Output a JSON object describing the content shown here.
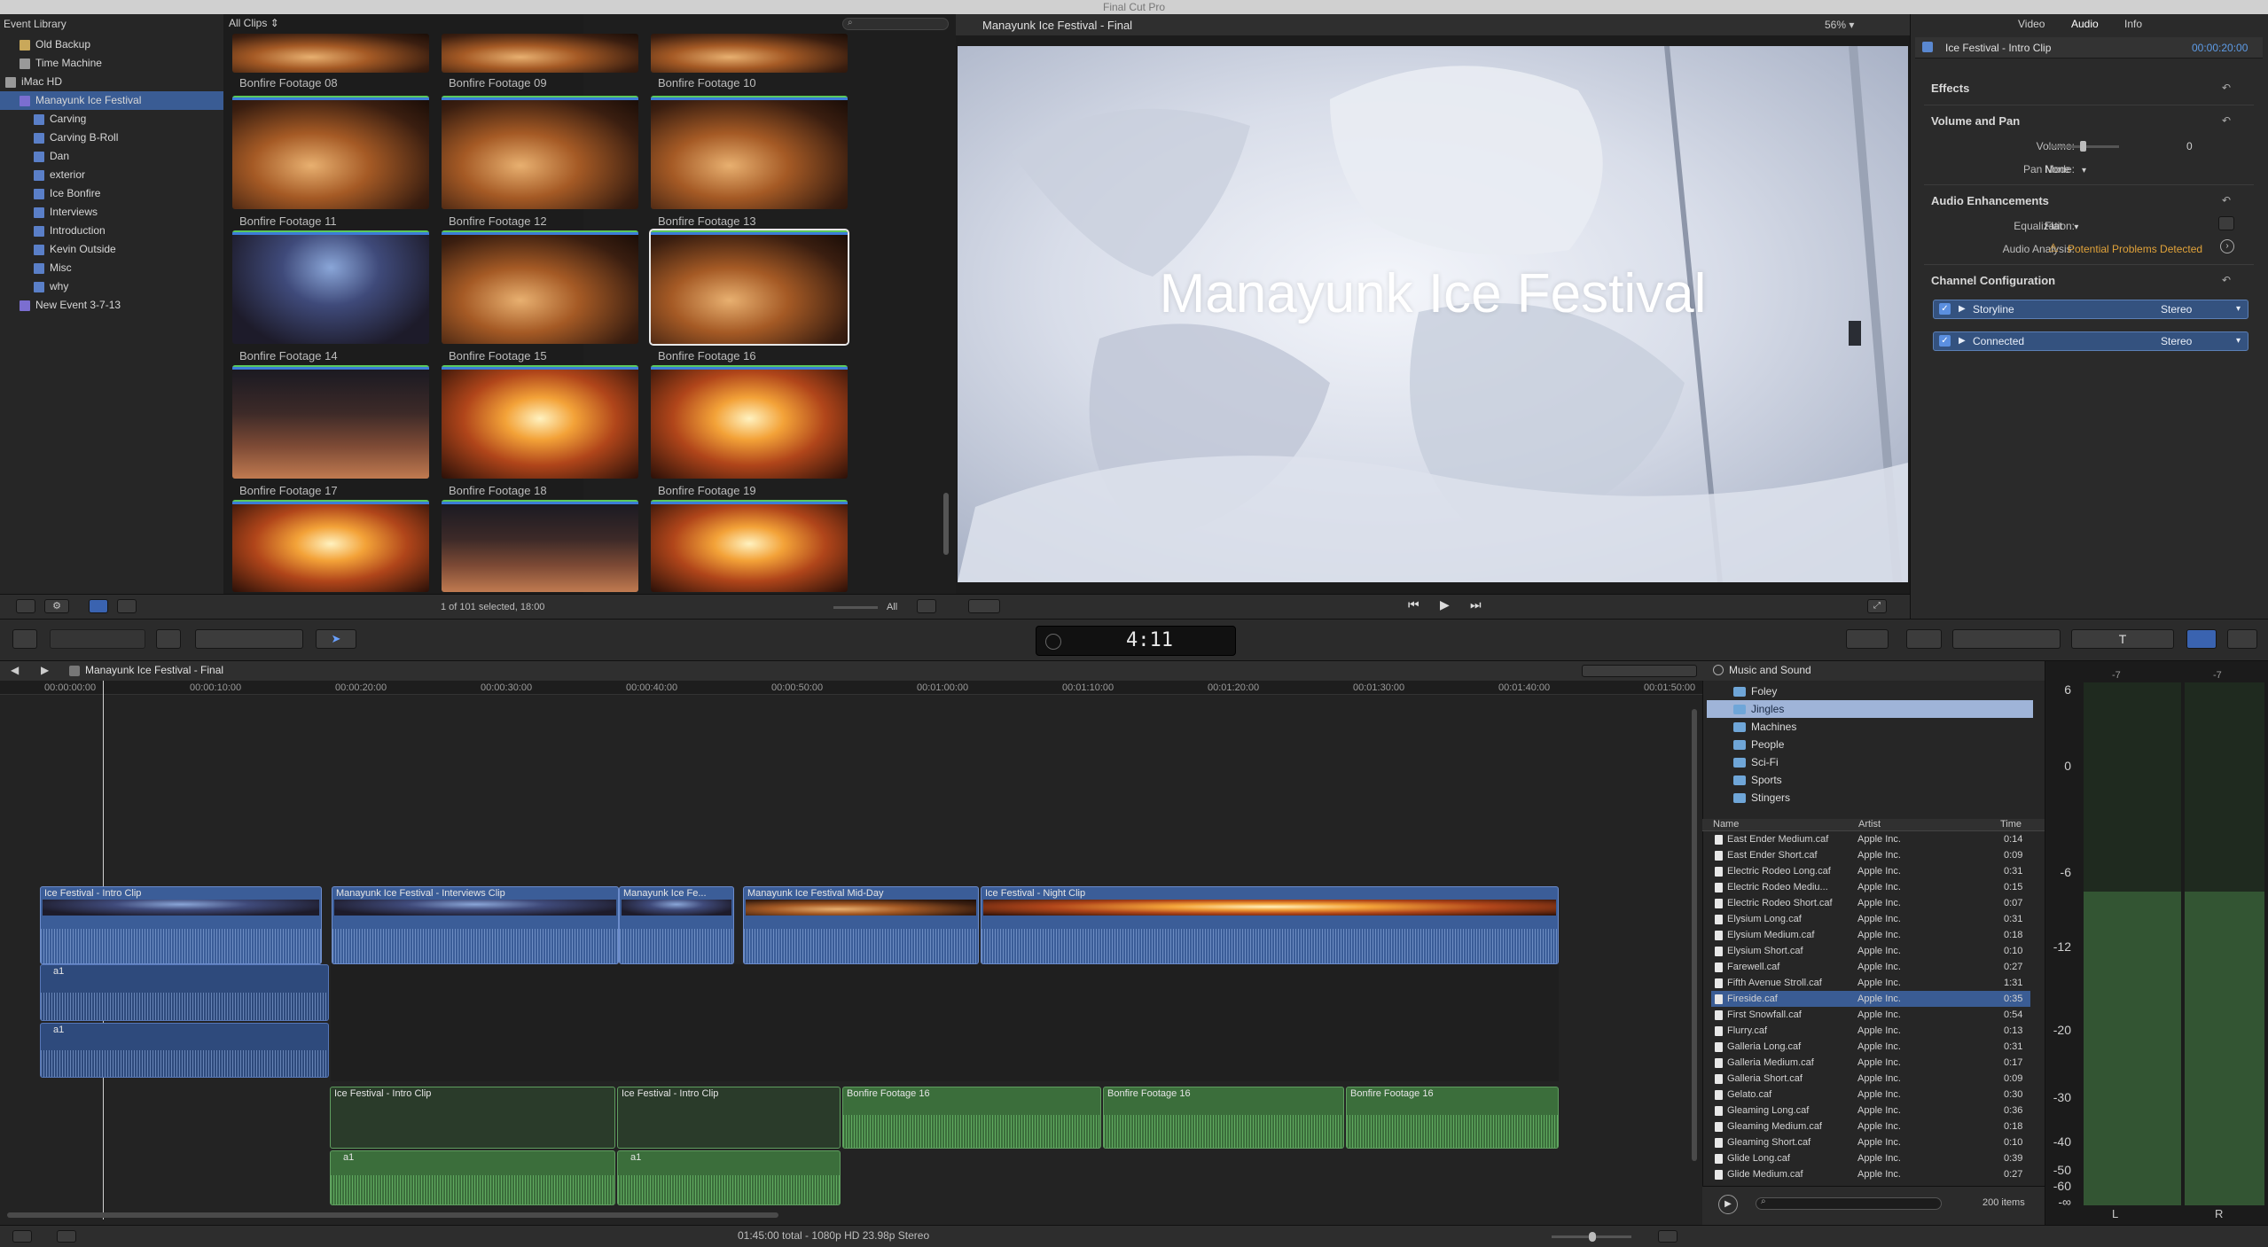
{
  "app": {
    "title": "Final Cut Pro"
  },
  "library": {
    "header": "Event Library",
    "items": [
      {
        "label": "Old Backup",
        "icon": "folder-icon",
        "indent": 1
      },
      {
        "label": "Time Machine",
        "icon": "disk-icon",
        "indent": 1
      },
      {
        "label": "iMac HD",
        "icon": "disk-icon",
        "indent": 0
      },
      {
        "label": "Manayunk Ice Festival",
        "icon": "event-icon",
        "indent": 1,
        "selected": true
      },
      {
        "label": "Carving",
        "icon": "keyword-icon",
        "indent": 2
      },
      {
        "label": "Carving B-Roll",
        "icon": "keyword-icon",
        "indent": 2
      },
      {
        "label": "Dan",
        "icon": "keyword-icon",
        "indent": 2
      },
      {
        "label": "exterior",
        "icon": "keyword-icon",
        "indent": 2
      },
      {
        "label": "Ice Bonfire",
        "icon": "keyword-icon",
        "indent": 2
      },
      {
        "label": "Interviews",
        "icon": "keyword-icon",
        "indent": 2
      },
      {
        "label": "Introduction",
        "icon": "keyword-icon",
        "indent": 2
      },
      {
        "label": "Kevin Outside",
        "icon": "keyword-icon",
        "indent": 2
      },
      {
        "label": "Misc",
        "icon": "keyword-icon",
        "indent": 2
      },
      {
        "label": "why",
        "icon": "keyword-icon",
        "indent": 2
      },
      {
        "label": "New Event 3-7-13",
        "icon": "event-icon",
        "indent": 1
      }
    ]
  },
  "browser": {
    "filter": "All Clips",
    "status": "1 of 101 selected, 18:00",
    "show": "All",
    "clips": [
      "Bonfire Footage 08",
      "Bonfire Footage 09",
      "Bonfire Footage 10",
      "Bonfire Footage 11",
      "Bonfire Footage 12",
      "Bonfire Footage 13",
      "Bonfire Footage 14",
      "Bonfire Footage 15",
      "Bonfire Footage 16",
      "Bonfire Footage 17",
      "Bonfire Footage 18",
      "Bonfire Footage 19"
    ]
  },
  "viewer": {
    "title": "Manayunk Ice Festival - Final",
    "zoom": "56%",
    "overlay_text": "Manayunk Ice Festival"
  },
  "inspector": {
    "tabs": [
      "Video",
      "Audio",
      "Info"
    ],
    "active_tab": "Audio",
    "clip_name": "Ice Festival - Intro Clip",
    "clip_time": "00:00:20:00",
    "sections": {
      "effects": "Effects",
      "volume_pan": "Volume and Pan",
      "volume_label": "Volume:",
      "volume_value": "0",
      "pan_mode_label": "Pan Mode:",
      "pan_mode_value": "None",
      "audio_enh": "Audio Enhancements",
      "eq_label": "Equalization:",
      "eq_value": "Flat",
      "analysis_label": "Audio Analysis:",
      "analysis_value": "Potential Problems Detected",
      "channel_config": "Channel Configuration"
    },
    "channels": [
      {
        "name": "Storyline",
        "mode": "Stereo"
      },
      {
        "name": "Connected",
        "mode": "Stereo"
      }
    ]
  },
  "timecode": {
    "display": "4:11"
  },
  "timeline": {
    "title": "Manayunk Ice Festival - Final",
    "ruler": [
      "00:00:00:00",
      "00:00:10:00",
      "00:00:20:00",
      "00:00:30:00",
      "00:00:40:00",
      "00:00:50:00",
      "00:01:00:00",
      "00:01:10:00",
      "00:01:20:00",
      "00:01:30:00",
      "00:01:40:00",
      "00:01:50:00"
    ],
    "primary_clips": [
      "Ice Festival - Intro Clip",
      "Manayunk Ice Festival - Interviews Clip",
      "Manayunk Ice Fe...",
      "Manayunk Ice Festival Mid-Day",
      "Ice Festival - Night Clip"
    ],
    "audio_a1": "a1",
    "connected_clips": [
      "Ice Festival - Intro Clip",
      "Ice Festival - Intro Clip",
      "Bonfire Footage 16",
      "Bonfire Footage 16",
      "Bonfire Footage 16"
    ],
    "status": "01:45:00 total - 1080p HD 23.98p Stereo"
  },
  "sound_browser": {
    "title": "Music and Sound",
    "folders": [
      "Foley",
      "Jingles",
      "Machines",
      "People",
      "Sci-Fi",
      "Sports",
      "Stingers"
    ],
    "selected_folder": "Jingles",
    "columns": {
      "name": "Name",
      "artist": "Artist",
      "time": "Time"
    },
    "rows": [
      {
        "name": "East Ender Medium.caf",
        "artist": "Apple Inc.",
        "time": "0:14"
      },
      {
        "name": "East Ender Short.caf",
        "artist": "Apple Inc.",
        "time": "0:09"
      },
      {
        "name": "Electric Rodeo Long.caf",
        "artist": "Apple Inc.",
        "time": "0:31"
      },
      {
        "name": "Electric Rodeo Mediu...",
        "artist": "Apple Inc.",
        "time": "0:15"
      },
      {
        "name": "Electric Rodeo Short.caf",
        "artist": "Apple Inc.",
        "time": "0:07"
      },
      {
        "name": "Elysium Long.caf",
        "artist": "Apple Inc.",
        "time": "0:31"
      },
      {
        "name": "Elysium Medium.caf",
        "artist": "Apple Inc.",
        "time": "0:18"
      },
      {
        "name": "Elysium Short.caf",
        "artist": "Apple Inc.",
        "time": "0:10"
      },
      {
        "name": "Farewell.caf",
        "artist": "Apple Inc.",
        "time": "0:27"
      },
      {
        "name": "Fifth Avenue Stroll.caf",
        "artist": "Apple Inc.",
        "time": "1:31"
      },
      {
        "name": "Fireside.caf",
        "artist": "Apple Inc.",
        "time": "0:35",
        "selected": true
      },
      {
        "name": "First Snowfall.caf",
        "artist": "Apple Inc.",
        "time": "0:54"
      },
      {
        "name": "Flurry.caf",
        "artist": "Apple Inc.",
        "time": "0:13"
      },
      {
        "name": "Galleria Long.caf",
        "artist": "Apple Inc.",
        "time": "0:31"
      },
      {
        "name": "Galleria Medium.caf",
        "artist": "Apple Inc.",
        "time": "0:17"
      },
      {
        "name": "Galleria Short.caf",
        "artist": "Apple Inc.",
        "time": "0:09"
      },
      {
        "name": "Gelato.caf",
        "artist": "Apple Inc.",
        "time": "0:30"
      },
      {
        "name": "Gleaming Long.caf",
        "artist": "Apple Inc.",
        "time": "0:36"
      },
      {
        "name": "Gleaming Medium.caf",
        "artist": "Apple Inc.",
        "time": "0:18"
      },
      {
        "name": "Gleaming Short.caf",
        "artist": "Apple Inc.",
        "time": "0:10"
      },
      {
        "name": "Glide Long.caf",
        "artist": "Apple Inc.",
        "time": "0:39"
      },
      {
        "name": "Glide Medium.caf",
        "artist": "Apple Inc.",
        "time": "0:27"
      }
    ],
    "count": "200 items"
  },
  "meters": {
    "ticks": [
      "6",
      "0",
      "-6",
      "-12",
      "-20",
      "-30",
      "-40",
      "-50",
      "-60",
      "-∞"
    ],
    "peak_left": "-7",
    "peak_right": "-7",
    "left": "L",
    "right": "R"
  },
  "colors": {
    "accent": "#3b7dd8",
    "selection": "#3a5c94",
    "warning": "#e0a23a"
  }
}
